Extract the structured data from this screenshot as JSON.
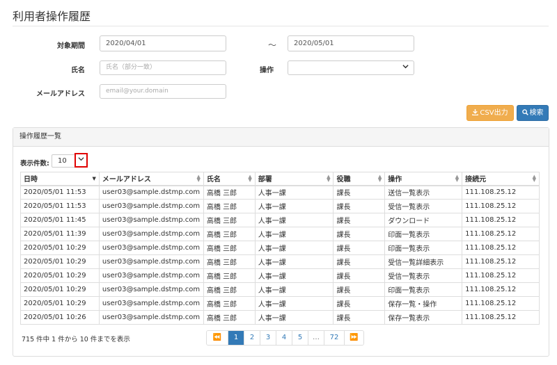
{
  "page": {
    "title": "利用者操作履歴"
  },
  "filters": {
    "period_label": "対象期間",
    "period_from": "2020/04/01",
    "tilde": "～",
    "period_to": "2020/05/01",
    "name_label": "氏名",
    "name_placeholder": "氏名（部分一致）",
    "operation_label": "操作",
    "operation_value": "",
    "email_label": "メールアドレス",
    "email_placeholder": "email@your.domain"
  },
  "actions": {
    "csv_label": "CSV出力",
    "search_label": "検索"
  },
  "panel": {
    "title": "操作履歴一覧"
  },
  "pagesize": {
    "label": "表示件数:",
    "value": "10"
  },
  "table": {
    "columns": [
      "日時",
      "メールアドレス",
      "氏名",
      "部署",
      "役職",
      "操作",
      "接続元"
    ],
    "rows": [
      [
        "2020/05/01 11:53",
        "user03@sample.dstmp.com",
        "高橋 三郎",
        "人事一課",
        "課長",
        "送信一覧表示",
        "111.108.25.12"
      ],
      [
        "2020/05/01 11:53",
        "user03@sample.dstmp.com",
        "高橋 三郎",
        "人事一課",
        "課長",
        "受信一覧表示",
        "111.108.25.12"
      ],
      [
        "2020/05/01 11:45",
        "user03@sample.dstmp.com",
        "高橋 三郎",
        "人事一課",
        "課長",
        "ダウンロード",
        "111.108.25.12"
      ],
      [
        "2020/05/01 11:39",
        "user03@sample.dstmp.com",
        "高橋 三郎",
        "人事一課",
        "課長",
        "印面一覧表示",
        "111.108.25.12"
      ],
      [
        "2020/05/01 10:29",
        "user03@sample.dstmp.com",
        "高橋 三郎",
        "人事一課",
        "課長",
        "印面一覧表示",
        "111.108.25.12"
      ],
      [
        "2020/05/01 10:29",
        "user03@sample.dstmp.com",
        "高橋 三郎",
        "人事一課",
        "課長",
        "受信一覧詳細表示",
        "111.108.25.12"
      ],
      [
        "2020/05/01 10:29",
        "user03@sample.dstmp.com",
        "高橋 三郎",
        "人事一課",
        "課長",
        "受信一覧表示",
        "111.108.25.12"
      ],
      [
        "2020/05/01 10:29",
        "user03@sample.dstmp.com",
        "高橋 三郎",
        "人事一課",
        "課長",
        "印面一覧表示",
        "111.108.25.12"
      ],
      [
        "2020/05/01 10:29",
        "user03@sample.dstmp.com",
        "高橋 三郎",
        "人事一課",
        "課長",
        "保存一覧・操作",
        "111.108.25.12"
      ],
      [
        "2020/05/01 10:26",
        "user03@sample.dstmp.com",
        "高橋 三郎",
        "人事一課",
        "課長",
        "保存一覧表示",
        "111.108.25.12"
      ]
    ]
  },
  "summary": "715 件中 1 件から 10 件までを表示",
  "pagination": {
    "first": "⏪",
    "pages": [
      "1",
      "2",
      "3",
      "4",
      "5",
      "…",
      "72"
    ],
    "last": "⏩",
    "active": "1"
  },
  "icons": {
    "download": "download-icon",
    "search": "search-icon",
    "dropdown": "chevron-down-icon"
  },
  "colors": {
    "primary": "#337ab7",
    "warning": "#f0ad4e",
    "highlight": "#e00000"
  }
}
